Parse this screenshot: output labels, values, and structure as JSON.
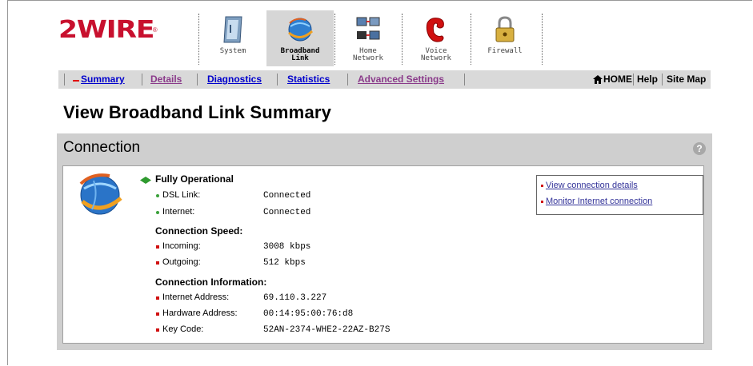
{
  "brand": {
    "logo_text": "2WIRE",
    "trademark": "®"
  },
  "nav": {
    "tabs": [
      {
        "label1": "System",
        "label2": "",
        "icon": "system-icon"
      },
      {
        "label1": "Broadband",
        "label2": "Link",
        "icon": "globe-icon",
        "active": true
      },
      {
        "label1": "Home",
        "label2": "Network",
        "icon": "home-network-icon"
      },
      {
        "label1": "Voice",
        "label2": "Network",
        "icon": "phone-icon"
      },
      {
        "label1": "Firewall",
        "label2": "",
        "icon": "lock-icon"
      }
    ]
  },
  "subnav": {
    "items": [
      {
        "label": "Summary",
        "state": "current"
      },
      {
        "label": "Details"
      },
      {
        "label": "Diagnostics"
      },
      {
        "label": "Statistics"
      },
      {
        "label": "Advanced Settings"
      }
    ],
    "right": {
      "home": "HOME",
      "help": "Help",
      "sitemap": "Site Map",
      "home_icon": "house-icon"
    }
  },
  "page": {
    "title": "View Broadband Link Summary"
  },
  "panel": {
    "title": "Connection",
    "help_icon": "question-icon",
    "status": "Fully Operational",
    "status_rows": [
      {
        "label": "DSL Link:",
        "value": "Connected"
      },
      {
        "label": "Internet:",
        "value": "Connected"
      }
    ],
    "speed_heading": "Connection Speed:",
    "speed_rows": [
      {
        "label": "Incoming:",
        "value": "3008 kbps"
      },
      {
        "label": "Outgoing:",
        "value": "512 kbps"
      }
    ],
    "info_heading": "Connection Information:",
    "info_rows": [
      {
        "label": "Internet Address:",
        "value": "69.110.3.227"
      },
      {
        "label": "Hardware Address:",
        "value": "00:14:95:00:76:d8"
      },
      {
        "label": "Key Code:",
        "value": "52AN-2374-WHE2-22AZ-B27S"
      }
    ],
    "links": [
      {
        "label": "View connection details"
      },
      {
        "label": "Monitor Internet connection"
      }
    ]
  },
  "colors": {
    "brand_red": "#c8102e",
    "link_blue": "#0000cc",
    "visited_purple": "#8a3a8a",
    "panel_gray": "#cfcfcf"
  }
}
